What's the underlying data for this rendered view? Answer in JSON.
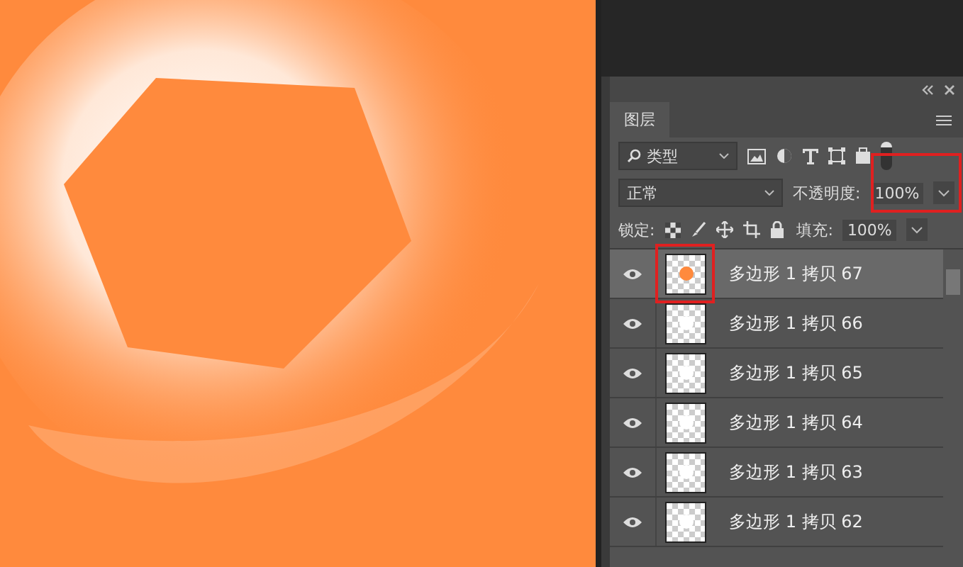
{
  "panel": {
    "tab": "图层",
    "filter": "类型",
    "blend_mode": "正常",
    "opacity_label": "不透明度:",
    "opacity": "100%",
    "lock_label": "锁定:",
    "fill_label": "填充:",
    "fill": "100%"
  },
  "layers": [
    {
      "name": "多边形 1 拷贝 67",
      "selected": true,
      "visible": true,
      "color": "#ff8a3d"
    },
    {
      "name": "多边形 1 拷贝 66",
      "selected": false,
      "visible": true,
      "color": "#ffffff"
    },
    {
      "name": "多边形 1 拷贝 65",
      "selected": false,
      "visible": true,
      "color": "#ffffff"
    },
    {
      "name": "多边形 1 拷贝 64",
      "selected": false,
      "visible": true,
      "color": "#ffffff"
    },
    {
      "name": "多边形 1 拷贝 63",
      "selected": false,
      "visible": true,
      "color": "#ffffff"
    },
    {
      "name": "多边形 1 拷贝 62",
      "selected": false,
      "visible": true,
      "color": "#ffffff"
    }
  ]
}
